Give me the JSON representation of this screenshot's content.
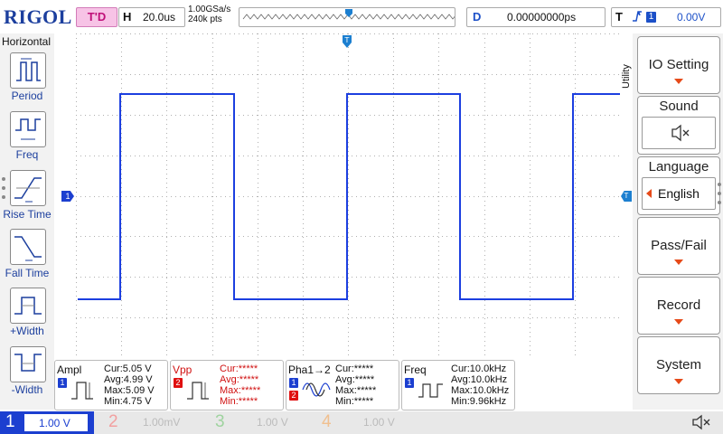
{
  "brand": "RIGOL",
  "topbar": {
    "trigger_status": "T'D",
    "horizontal_label": "H",
    "timebase": "20.0us",
    "sample_rate": "1.00GSa/s",
    "memory_depth": "240k pts",
    "delay_label": "D",
    "delay_value": "0.00000000ps",
    "trigger_label": "T",
    "trigger_source": "1",
    "trigger_level": "0.00V"
  },
  "left_panel": {
    "title": "Horizontal",
    "items": [
      {
        "label": "Period",
        "icon": "period-icon"
      },
      {
        "label": "Freq",
        "icon": "freq-icon"
      },
      {
        "label": "Rise Time",
        "icon": "rise-time-icon"
      },
      {
        "label": "Fall Time",
        "icon": "fall-time-icon"
      },
      {
        "label": "+Width",
        "icon": "plus-width-icon"
      },
      {
        "label": "-Width",
        "icon": "minus-width-icon"
      }
    ]
  },
  "right_menu": {
    "title": "Utility",
    "items": [
      {
        "label": "IO Setting"
      },
      {
        "label": "Sound"
      },
      {
        "label": "Language",
        "value": "English"
      },
      {
        "label": "Pass/Fail"
      },
      {
        "label": "Record"
      },
      {
        "label": "System"
      }
    ]
  },
  "markers": {
    "ch1_marker": "1"
  },
  "measurements": [
    {
      "name": "Ampl",
      "channel": "1",
      "cur": "Cur:5.05 V",
      "avg": "Avg:4.99 V",
      "max": "Max:5.09 V",
      "min": "Min:4.75 V"
    },
    {
      "name": "Vpp",
      "channel": "2",
      "cur": "Cur:*****",
      "avg": "Avg:*****",
      "max": "Max:*****",
      "min": "Min:*****"
    },
    {
      "name": "Pha1→2",
      "channel": "1",
      "channel2": "2",
      "cur": "Cur:*****",
      "avg": "Avg:*****",
      "max": "Max:*****",
      "min": "Min:*****"
    },
    {
      "name": "Freq",
      "channel": "1",
      "cur": "Cur:10.0kHz",
      "avg": "Avg:10.0kHz",
      "max": "Max:10.0kHz",
      "min": "Min:9.96kHz"
    }
  ],
  "channels": [
    {
      "num": "1",
      "scale": "1.00 V"
    },
    {
      "num": "2",
      "scale": "1.00mV"
    },
    {
      "num": "3",
      "scale": "1.00 V"
    },
    {
      "num": "4",
      "scale": "1.00 V"
    }
  ],
  "colors": {
    "ch1": "#1c3fd0",
    "ch2": "#e01010",
    "ch3": "#2e9e3e",
    "ch4": "#e07a20",
    "trace": "#1c3fe0"
  }
}
